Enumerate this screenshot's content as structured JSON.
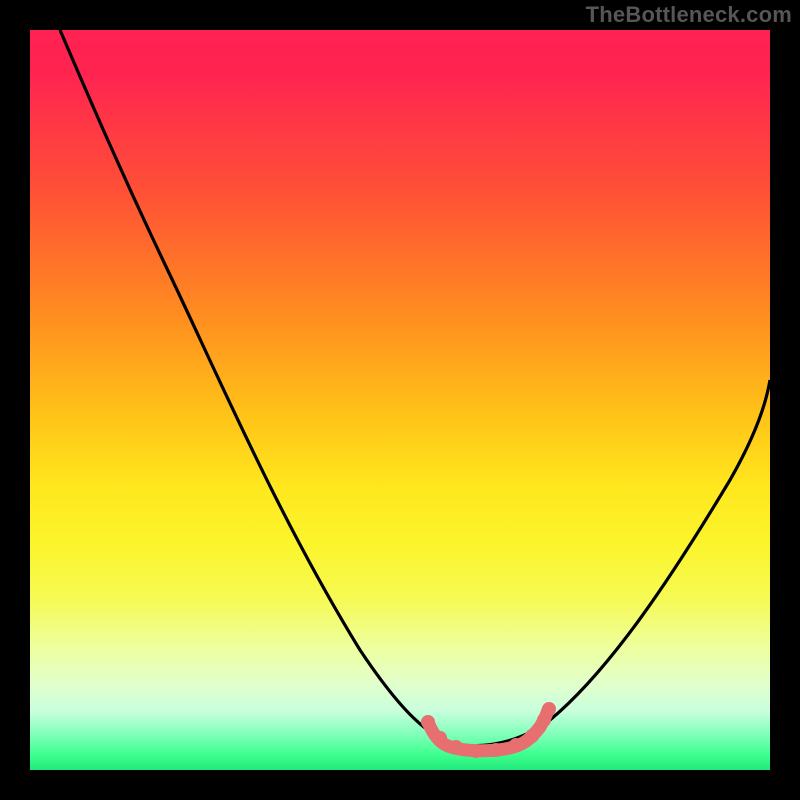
{
  "attribution": "TheBottleneck.com",
  "colors": {
    "frame": "#000000",
    "curve": "#000000",
    "bottom_marker": "#e76f6f",
    "gradient_top": "#ff2152",
    "gradient_bottom": "#22e97b"
  },
  "chart_data": {
    "type": "line",
    "title": "",
    "xlabel": "",
    "ylabel": "",
    "xlim": [
      0,
      100
    ],
    "ylim": [
      0,
      100
    ],
    "series": [
      {
        "name": "bottleneck-curve",
        "x": [
          4,
          10,
          16,
          22,
          28,
          34,
          40,
          46,
          50,
          54,
          57,
          60,
          64,
          68,
          74,
          80,
          86,
          92,
          98,
          100
        ],
        "y": [
          100,
          91,
          82,
          72,
          62,
          52,
          41,
          30,
          21,
          13,
          7,
          4,
          4,
          7,
          14,
          23,
          32,
          41,
          50,
          53
        ]
      }
    ],
    "annotations": [
      {
        "name": "optimal-range",
        "x_start": 55,
        "x_end": 70,
        "y": 3
      }
    ]
  }
}
